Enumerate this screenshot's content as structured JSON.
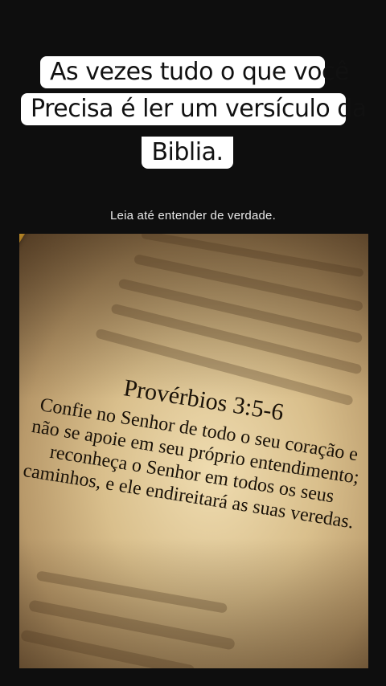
{
  "caption": {
    "line1": "As vezes tudo o que você",
    "line2": "Precisa é ler um versículo da",
    "line3": "Biblia."
  },
  "subtitle": "Leia até entender de verdade.",
  "image": {
    "reference": "Provérbios 3:5-6",
    "verse": "Confie no Senhor de todo o seu coração e não se apoie em seu próprio entendimento; reconheça o Senhor em todos os seus caminhos, e ele endireitará as suas veredas."
  }
}
